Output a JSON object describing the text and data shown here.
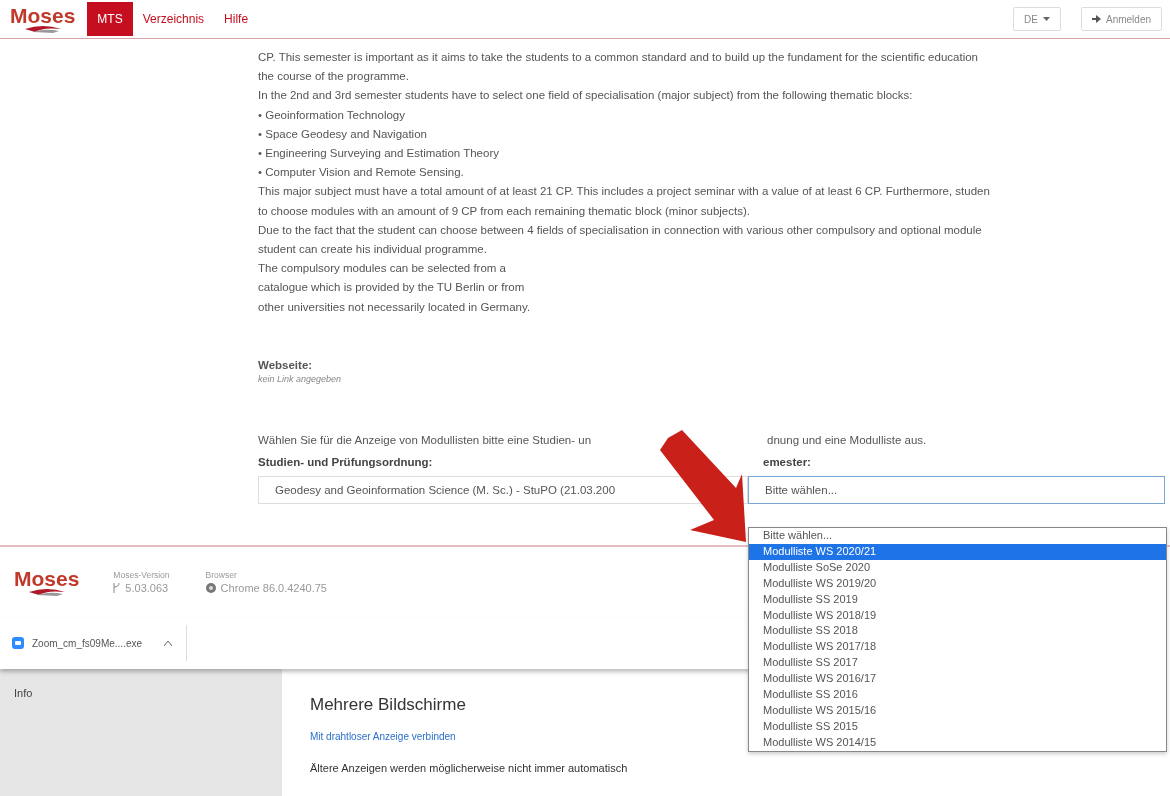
{
  "header": {
    "logo": "Moses",
    "nav": [
      {
        "label": "MTS",
        "selected": true
      },
      {
        "label": "Verzeichnis",
        "selected": false
      },
      {
        "label": "Hilfe",
        "selected": false
      }
    ],
    "language": "DE",
    "login": "Anmelden"
  },
  "description": [
    "CP. This semester is important as it aims to take the students to a common standard and to build up the fundament for the scientific education",
    "the course of the programme.",
    "In the 2nd and 3rd semester students have to select one field of specialisation (major subject) from the following thematic blocks:",
    "• Geoinformation Technology",
    "• Space Geodesy and Navigation",
    "• Engineering Surveying and Estimation Theory",
    "• Computer Vision and Remote Sensing.",
    "This major subject must have a total amount of at least 21 CP. This includes a project seminar with a value of at least 6 CP. Furthermore, studen",
    "to choose modules with an amount of 9 CP from each remaining thematic block (minor subjects).",
    "Due to the fact that the student can choose between 4 fields of specialisation in connection with various other compulsory and optional module",
    "student can create his individual programme.",
    "The compulsory modules can be selected from a",
    "catalogue which is provided by the TU Berlin or from",
    "other universities not necessarily located in Germany."
  ],
  "website": {
    "label": "Webseite:",
    "value": "kein Link angegeben"
  },
  "instruction": [
    "Wählen Sie für die Anzeige von Modullisten bitte eine Studien- un",
    "dnung und eine Modulliste aus."
  ],
  "fields": [
    {
      "label": "Studien- und Prüfungsordnung:",
      "value": "Geodesy and Geoinformation Science (M. Sc.) - StuPO (21.03.200",
      "focused": false
    },
    {
      "label": "emester:",
      "value": "Bitte wählen...",
      "focused": true
    }
  ],
  "dropdown": [
    {
      "label": "Bitte wählen...",
      "selected": false
    },
    {
      "label": "Modulliste WS 2020/21",
      "selected": true
    },
    {
      "label": "Modulliste SoSe 2020",
      "selected": false
    },
    {
      "label": "Modulliste WS 2019/20",
      "selected": false
    },
    {
      "label": "Modulliste SS 2019",
      "selected": false
    },
    {
      "label": "Modulliste WS 2018/19",
      "selected": false
    },
    {
      "label": "Modulliste SS 2018",
      "selected": false
    },
    {
      "label": "Modulliste WS 2017/18",
      "selected": false
    },
    {
      "label": "Modulliste SS 2017",
      "selected": false
    },
    {
      "label": "Modulliste WS 2016/17",
      "selected": false
    },
    {
      "label": "Modulliste SS 2016",
      "selected": false
    },
    {
      "label": "Modulliste WS 2015/16",
      "selected": false
    },
    {
      "label": "Modulliste SS 2015",
      "selected": false
    },
    {
      "label": "Modulliste WS 2014/15",
      "selected": false
    }
  ],
  "footer": {
    "logo": "Moses",
    "version_label": "Moses-Version",
    "version": "5.03.063",
    "browser_label": "Browser",
    "browser": "Chrome 86.0.4240.75"
  },
  "download": {
    "file": "Zoom_cm_fs09Me....exe"
  },
  "settings": {
    "nav": "Info",
    "title": "Mehrere Bildschirme",
    "link": "Mit drahtloser Anzeige verbinden",
    "text": "Ältere Anzeigen werden möglicherweise nicht immer automatisch"
  }
}
